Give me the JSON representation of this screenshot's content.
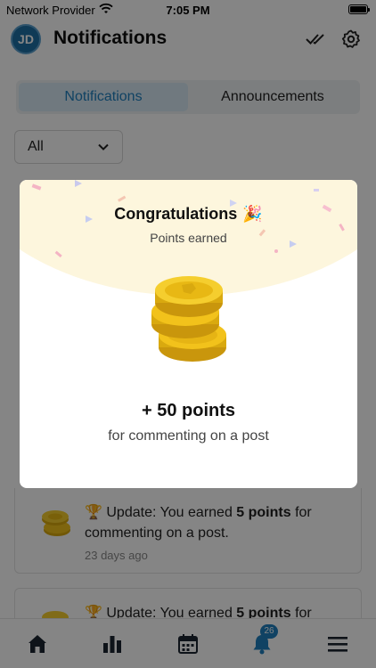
{
  "status_bar": {
    "carrier": "Network Provider",
    "time": "7:05 PM"
  },
  "header": {
    "avatar_initials": "JD",
    "title": "Notifications",
    "icons": [
      "double-check-icon",
      "gear-icon"
    ]
  },
  "tabs": [
    {
      "label": "Notifications",
      "active": true
    },
    {
      "label": "Announcements",
      "active": false
    }
  ],
  "filter": {
    "selected": "All"
  },
  "notifications": [
    {
      "prefix": "Update: You earned ",
      "bold": "5 points",
      "suffix": " for commenting on a post.",
      "time": "23 days ago",
      "icon": "trophy-icon"
    },
    {
      "prefix": "Update: You earned ",
      "bold": "5 points",
      "suffix": " for",
      "time": "",
      "icon": "trophy-icon"
    }
  ],
  "tabbar": {
    "items": [
      "home-icon",
      "chart-icon",
      "calendar-icon",
      "bell-icon",
      "menu-icon"
    ],
    "badge_count": "26"
  },
  "modal": {
    "title": "Congratulations",
    "subtitle": "Points earned",
    "points": "+ 50 points",
    "reason": "for commenting on a post"
  },
  "colors": {
    "accent": "#1f7fbf",
    "coin": "#f2c21b",
    "banner": "#fdf6dd"
  }
}
